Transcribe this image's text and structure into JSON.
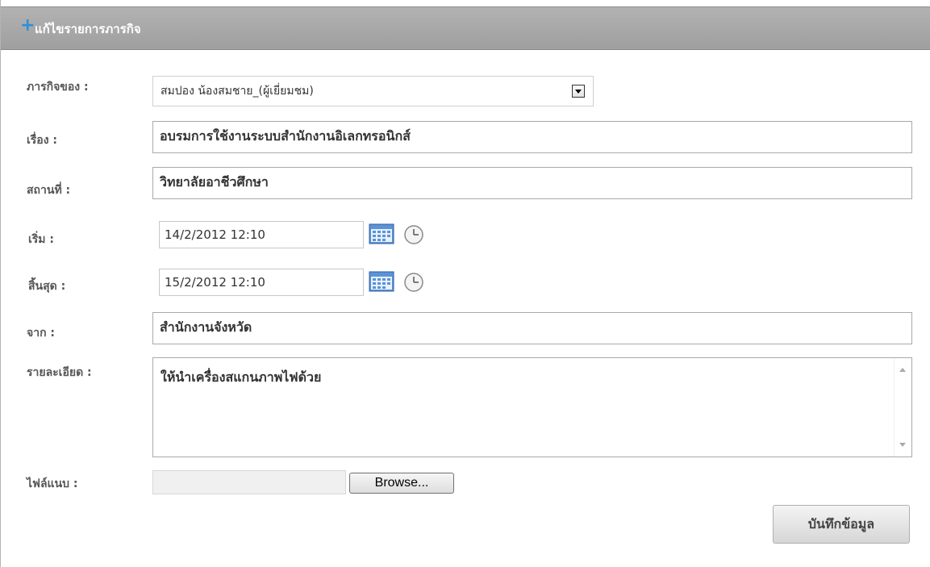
{
  "header": {
    "title": "แก้ไขรายการภารกิจ"
  },
  "form": {
    "owner": {
      "label": "ภารกิจของ :",
      "value": "สมปอง น้องสมชาย_(ผู้เยี่ยมชม)"
    },
    "subject": {
      "label": "เรื่อง :",
      "value": "อบรมการใช้งานระบบสำนักงานอิเลกทรอนิกส์"
    },
    "location": {
      "label": "สถานที่ :",
      "value": "วิทยาลัยอาชีวศึกษา"
    },
    "start": {
      "label": "เริ่ม :",
      "value": "14/2/2012 12:10"
    },
    "end": {
      "label": "สิ้นสุด :",
      "value": "15/2/2012 12:10"
    },
    "from": {
      "label": "จาก :",
      "value": "สำนักงานจังหวัด"
    },
    "details": {
      "label": "รายละเอียด :",
      "value": "ให้นำเครื่องสแกนภาพไฟด้วย"
    },
    "attachment": {
      "label": "ไฟล์แนบ :",
      "browse_label": "Browse..."
    },
    "save_label": "บันทึกข้อมูล"
  },
  "colors": {
    "header_bg": "#a8a8a8",
    "accent": "#2f8fd8"
  },
  "icons": [
    "plus-icon",
    "calendar-icon",
    "clock-icon",
    "chevron-down-icon"
  ]
}
